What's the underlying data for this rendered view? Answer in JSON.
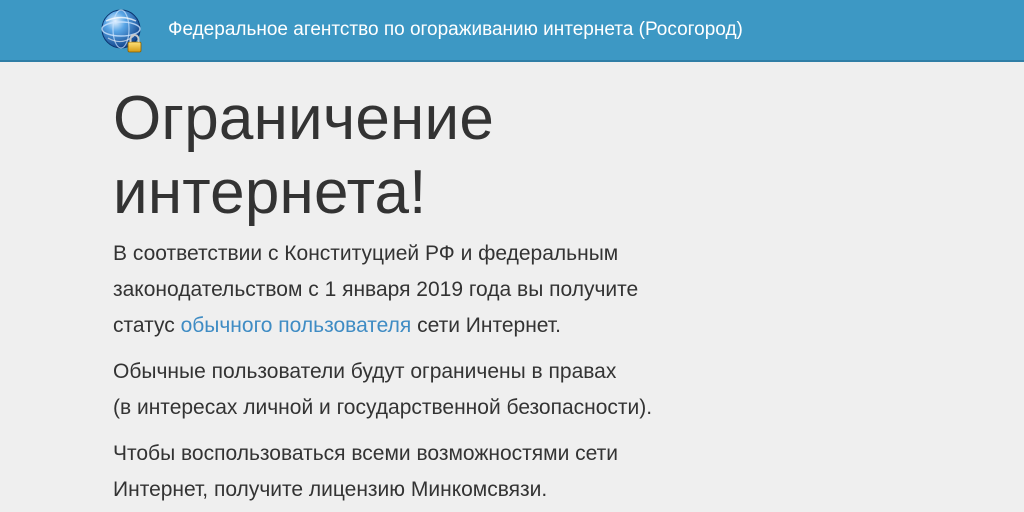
{
  "header": {
    "logo_icon": "globe-with-lock-icon",
    "title": "Федеральное агентство по огораживанию интернета (Росогород)",
    "background_color": "#3d98c4"
  },
  "main": {
    "headline_line1": "Ограничение",
    "headline_line2": "интернета!",
    "paragraph1": {
      "line1": "В соответствии с Конституцией РФ и федеральным",
      "line2": "законодательством с 1 января 2019 года вы получите",
      "line3_before_link": "статус ",
      "link_text": "обычного пользователя",
      "line3_after_link": " сети Интернет."
    },
    "paragraph2": {
      "line1": "Обычные пользователи будут ограничены в правах",
      "line2": "(в интересах личной и государственной безопасности)."
    },
    "paragraph3": {
      "line1": "Чтобы воспользоваться всеми возможностями сети",
      "line2": "Интернет, получите лицензию Минкомсвязи."
    },
    "link_color": "#3f8cc4"
  }
}
